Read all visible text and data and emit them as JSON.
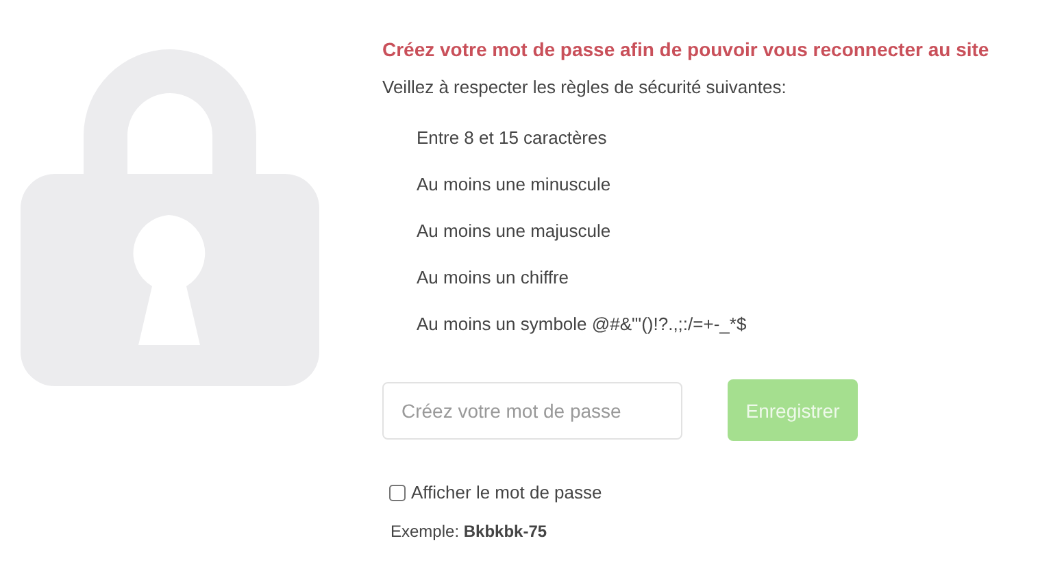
{
  "heading": "Créez votre mot de passe afin de pouvoir vous reconnecter au site",
  "intro": "Veillez à respecter les règles de sécurité suivantes:",
  "rules": [
    "Entre 8 et 15 caractères",
    "Au moins une minuscule",
    "Au moins une majuscule",
    "Au moins un chiffre",
    "Au moins un symbole @#&\"'()!?.,;:/=+-_*$"
  ],
  "password_field": {
    "placeholder": "Créez votre mot de passe"
  },
  "save_button": {
    "label": "Enregistrer",
    "disabled": true
  },
  "show_password": {
    "label": "Afficher le mot de passe",
    "checked": false
  },
  "example": "Exemple: **Bkbkbk-75**"
}
